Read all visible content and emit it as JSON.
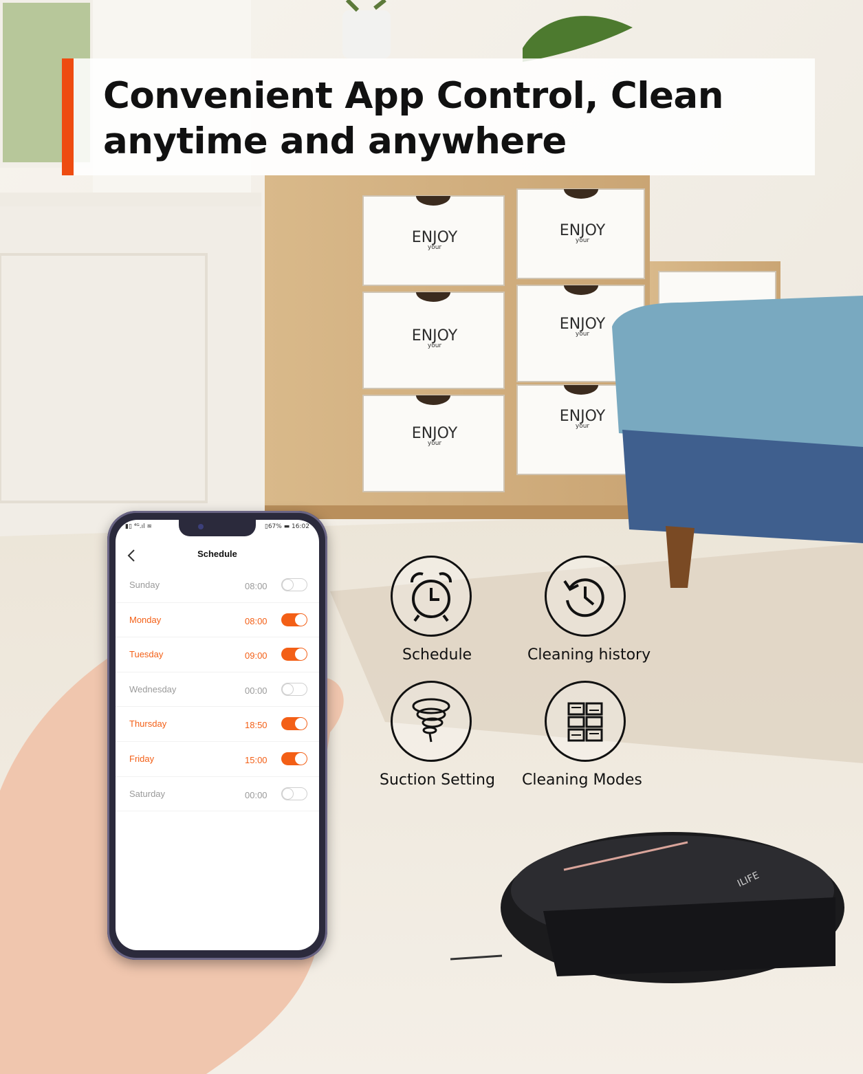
{
  "banner": {
    "title": "Convenient App Control, Clean anytime and anywhere",
    "accent_color": "#ee4c11"
  },
  "scene": {
    "drawer_text": "ENJOY",
    "drawer_subtext": "your",
    "robot_brand": "ILIFE"
  },
  "phone": {
    "status_left": "▮▯ ⁴ᴳ.ıl ≋",
    "status_right": "▯67% ▬ 16:02",
    "title": "Schedule",
    "back_icon": "chevron-left-icon",
    "on_color": "#f35f16",
    "schedule": [
      {
        "day": "Sunday",
        "time": "08:00",
        "enabled": false
      },
      {
        "day": "Monday",
        "time": "08:00",
        "enabled": true
      },
      {
        "day": "Tuesday",
        "time": "09:00",
        "enabled": true
      },
      {
        "day": "Wednesday",
        "time": "00:00",
        "enabled": false
      },
      {
        "day": "Thursday",
        "time": "18:50",
        "enabled": true
      },
      {
        "day": "Friday",
        "time": "15:00",
        "enabled": true
      },
      {
        "day": "Saturday",
        "time": "00:00",
        "enabled": false
      }
    ]
  },
  "features": [
    {
      "label": "Schedule",
      "icon": "alarm-clock-icon"
    },
    {
      "label": "Cleaning history",
      "icon": "history-clock-icon"
    },
    {
      "label": "Suction Setting",
      "icon": "suction-tornado-icon"
    },
    {
      "label": "Cleaning Modes",
      "icon": "cleaning-modes-grid-icon"
    }
  ]
}
